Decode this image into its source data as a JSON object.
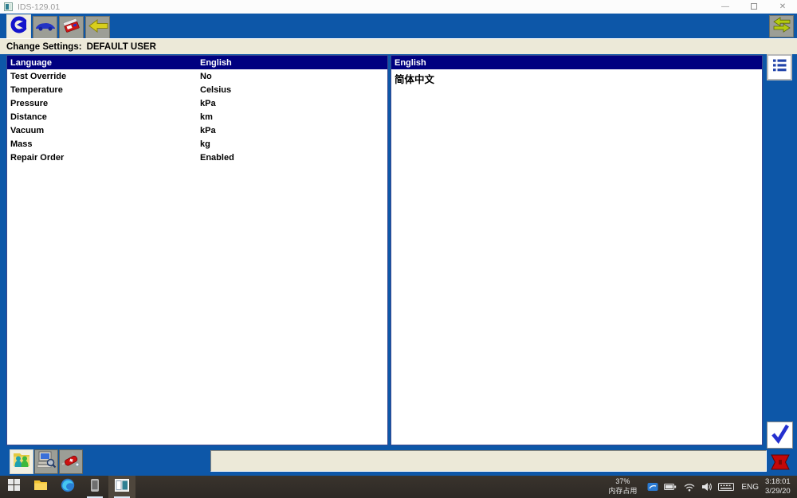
{
  "window": {
    "title": "IDS-129.01",
    "controls": {
      "minimize": "—",
      "close": "✕"
    }
  },
  "toolbar": {
    "tabs": [
      {
        "name": "session",
        "icon": "ids-session-icon",
        "selected": true
      },
      {
        "name": "vehicle",
        "icon": "car-icon",
        "selected": false
      },
      {
        "name": "toolbox",
        "icon": "engine-toolbox-icon",
        "selected": false
      },
      {
        "name": "previous",
        "icon": "yellow-arrow-icon",
        "selected": false
      }
    ],
    "swap_button_icon": "swap-arrows-icon"
  },
  "subheader": {
    "label": "Change Settings:",
    "user": "DEFAULT USER"
  },
  "settings_list": {
    "rows": [
      {
        "label": "Language",
        "value": "English",
        "selected": true
      },
      {
        "label": "Test Override",
        "value": "No"
      },
      {
        "label": "Temperature",
        "value": "Celsius"
      },
      {
        "label": "Pressure",
        "value": "kPa"
      },
      {
        "label": "Distance",
        "value": "km"
      },
      {
        "label": "Vacuum",
        "value": "kPa"
      },
      {
        "label": "Mass",
        "value": "kg"
      },
      {
        "label": "Repair Order",
        "value": "Enabled"
      }
    ]
  },
  "options_panel": {
    "header": "English",
    "options": [
      "简体中文"
    ]
  },
  "side_buttons": {
    "list_icon": "list-icon",
    "confirm_icon": "check-icon"
  },
  "bottom_tabs": [
    {
      "name": "users",
      "icon": "users-folder-icon",
      "selected": true
    },
    {
      "name": "system-search",
      "icon": "computer-search-icon",
      "selected": false
    },
    {
      "name": "tools",
      "icon": "swiss-knife-icon",
      "selected": false
    }
  ],
  "status_bar": {
    "text": ""
  },
  "vcm_indicator_icon": "vcm-red-icon",
  "taskbar": {
    "items": [
      "start",
      "file-explorer",
      "edge",
      "phone",
      "ids-app"
    ],
    "tray": {
      "memory_percent": "37%",
      "memory_label": "内存占用",
      "language": "ENG",
      "time": "3:18:01",
      "date": "3/29/20"
    }
  },
  "colors": {
    "window_blue": "#0d57a8",
    "selection_navy": "#000080",
    "beige": "#ece9d8",
    "tab_gray": "#9c9e96"
  }
}
